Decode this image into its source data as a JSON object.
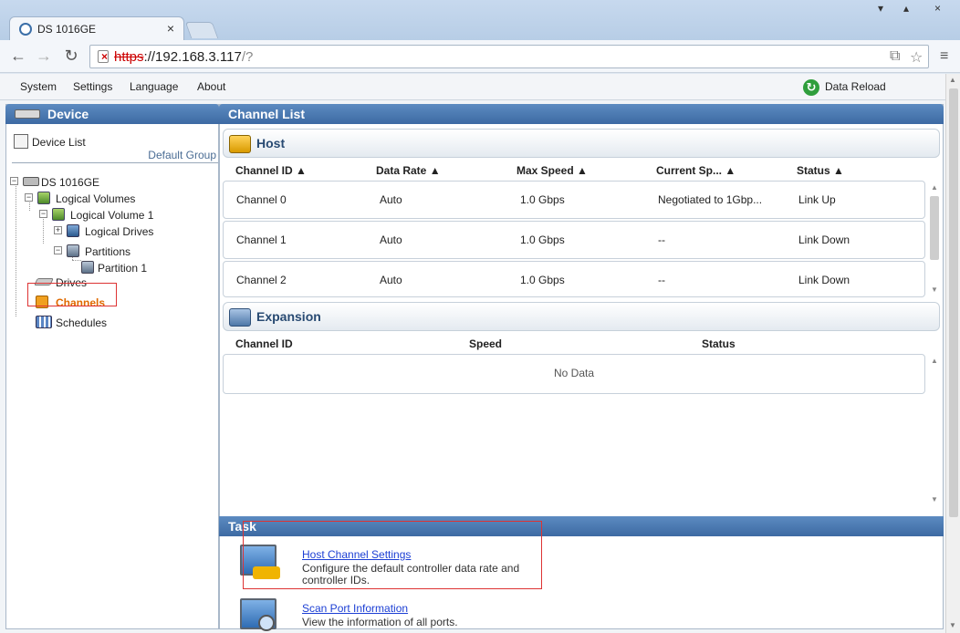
{
  "browser": {
    "tab_title": "DS 1016GE",
    "close_glyph": "×",
    "url_scheme": "https",
    "url_host": "://192.168.3.117",
    "url_path": "/?",
    "back_glyph": "←",
    "forward_glyph": "→",
    "reload_glyph": "↻",
    "star_glyph": "☆",
    "translate_glyph": "⧉",
    "menu_glyph": "≡"
  },
  "menubar": {
    "items": [
      "System",
      "Settings",
      "Language",
      "About"
    ],
    "reload_label": "Data Reload"
  },
  "left": {
    "title": "Device",
    "device_list": "Device List",
    "default_group": "Default Group",
    "tree": {
      "device": "DS 1016GE",
      "logical_volumes": "Logical Volumes",
      "logical_volume_1": "Logical Volume 1",
      "logical_drives": "Logical Drives",
      "partitions": "Partitions",
      "partition_1": "Partition 1",
      "drives": "Drives",
      "channels": "Channels",
      "schedules": "Schedules"
    }
  },
  "right": {
    "title": "Channel List",
    "host": {
      "title": "Host",
      "columns": [
        "Channel ID ▲",
        "Data Rate ▲",
        "Max Speed ▲",
        "Current Sp... ▲",
        "Status ▲"
      ],
      "rows": [
        [
          "Channel 0",
          "Auto",
          "1.0 Gbps",
          "Negotiated to 1Gbp...",
          "Link Up"
        ],
        [
          "Channel 1",
          "Auto",
          "1.0 Gbps",
          "--",
          "Link Down"
        ],
        [
          "Channel 2",
          "Auto",
          "1.0 Gbps",
          "--",
          "Link Down"
        ]
      ]
    },
    "expansion": {
      "title": "Expansion",
      "columns": [
        "Channel ID",
        "Speed",
        "Status"
      ],
      "empty": "No Data"
    },
    "task": {
      "title": "Task",
      "items": [
        {
          "link": "Host Channel Settings",
          "desc": "Configure the default controller data rate and controller IDs."
        },
        {
          "link": "Scan Port Information",
          "desc": "View the information of all ports."
        }
      ]
    }
  },
  "colors": {
    "accent": "#3d6aa3",
    "selected": "#e06a00",
    "link": "#1c3fd4",
    "highlight_box": "#dd3333"
  }
}
